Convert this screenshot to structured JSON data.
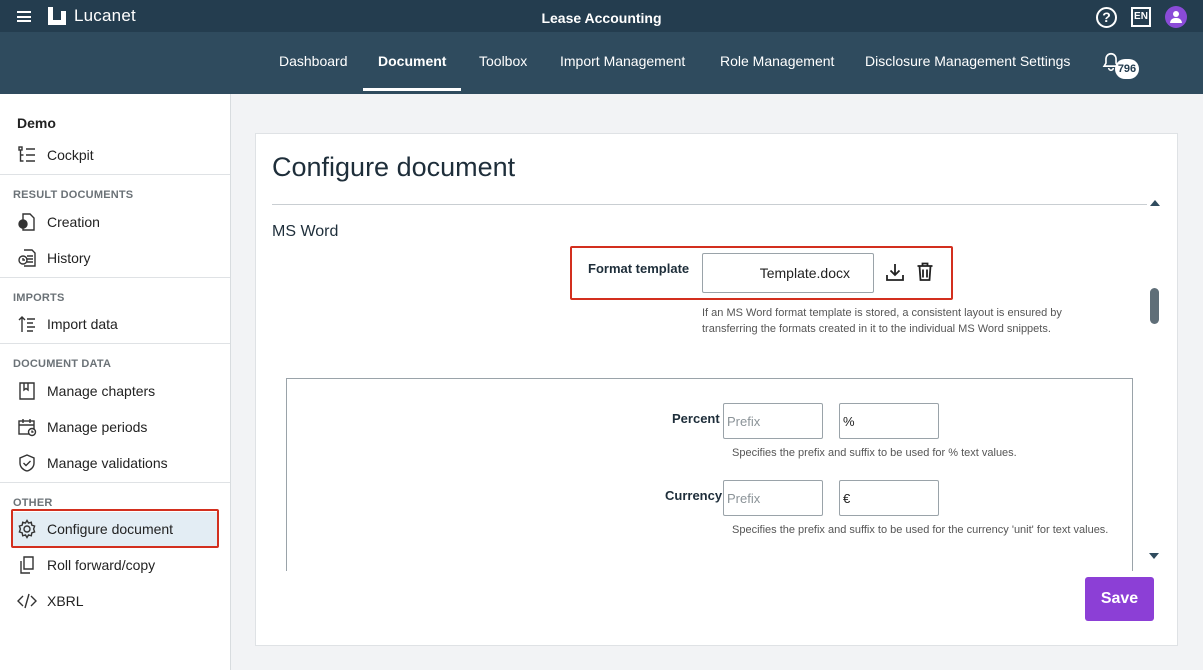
{
  "header": {
    "logo_text": "Lucanet",
    "app_title": "Lease Accounting",
    "help_symbol": "?",
    "language": "EN"
  },
  "nav": {
    "tabs": [
      {
        "label": "Dashboard"
      },
      {
        "label": "Document",
        "active": true
      },
      {
        "label": "Toolbox"
      },
      {
        "label": "Import Management"
      },
      {
        "label": "Role Management"
      },
      {
        "label": "Disclosure Management Settings"
      }
    ],
    "notification_count": "796"
  },
  "sidebar": {
    "context": "Demo",
    "cockpit": "Cockpit",
    "sections": {
      "result_documents": "RESULT DOCUMENTS",
      "imports": "IMPORTS",
      "document_data": "DOCUMENT DATA",
      "other": "OTHER"
    },
    "items": {
      "creation": "Creation",
      "history": "History",
      "import_data": "Import data",
      "manage_chapters": "Manage chapters",
      "manage_periods": "Manage periods",
      "manage_validations": "Manage validations",
      "configure_document": "Configure document",
      "roll_forward": "Roll forward/copy",
      "xbrl": "XBRL"
    },
    "active_item": "configure_document"
  },
  "main": {
    "title": "Configure document",
    "section_title": "MS Word",
    "format_template": {
      "label": "Format template",
      "file_name": "Template.docx",
      "help": "If an MS Word format template is stored, a consistent layout is ensured by transferring the formats created in it to the individual MS Word snippets."
    },
    "percent": {
      "label": "Percent",
      "prefix_placeholder": "Prefix",
      "prefix_value": "",
      "suffix_value": "%",
      "help": "Specifies the prefix and suffix to be used for % text values."
    },
    "currency": {
      "label": "Currency",
      "prefix_placeholder": "Prefix",
      "prefix_value": "",
      "suffix_value": "€",
      "help": "Specifies the prefix and suffix to be used for the currency 'unit' for text values."
    },
    "save_label": "Save"
  },
  "colors": {
    "topbar": "#243d4f",
    "navbar": "#2f4b5e",
    "accent": "#8c3fd6",
    "highlight": "#d32f1e"
  }
}
